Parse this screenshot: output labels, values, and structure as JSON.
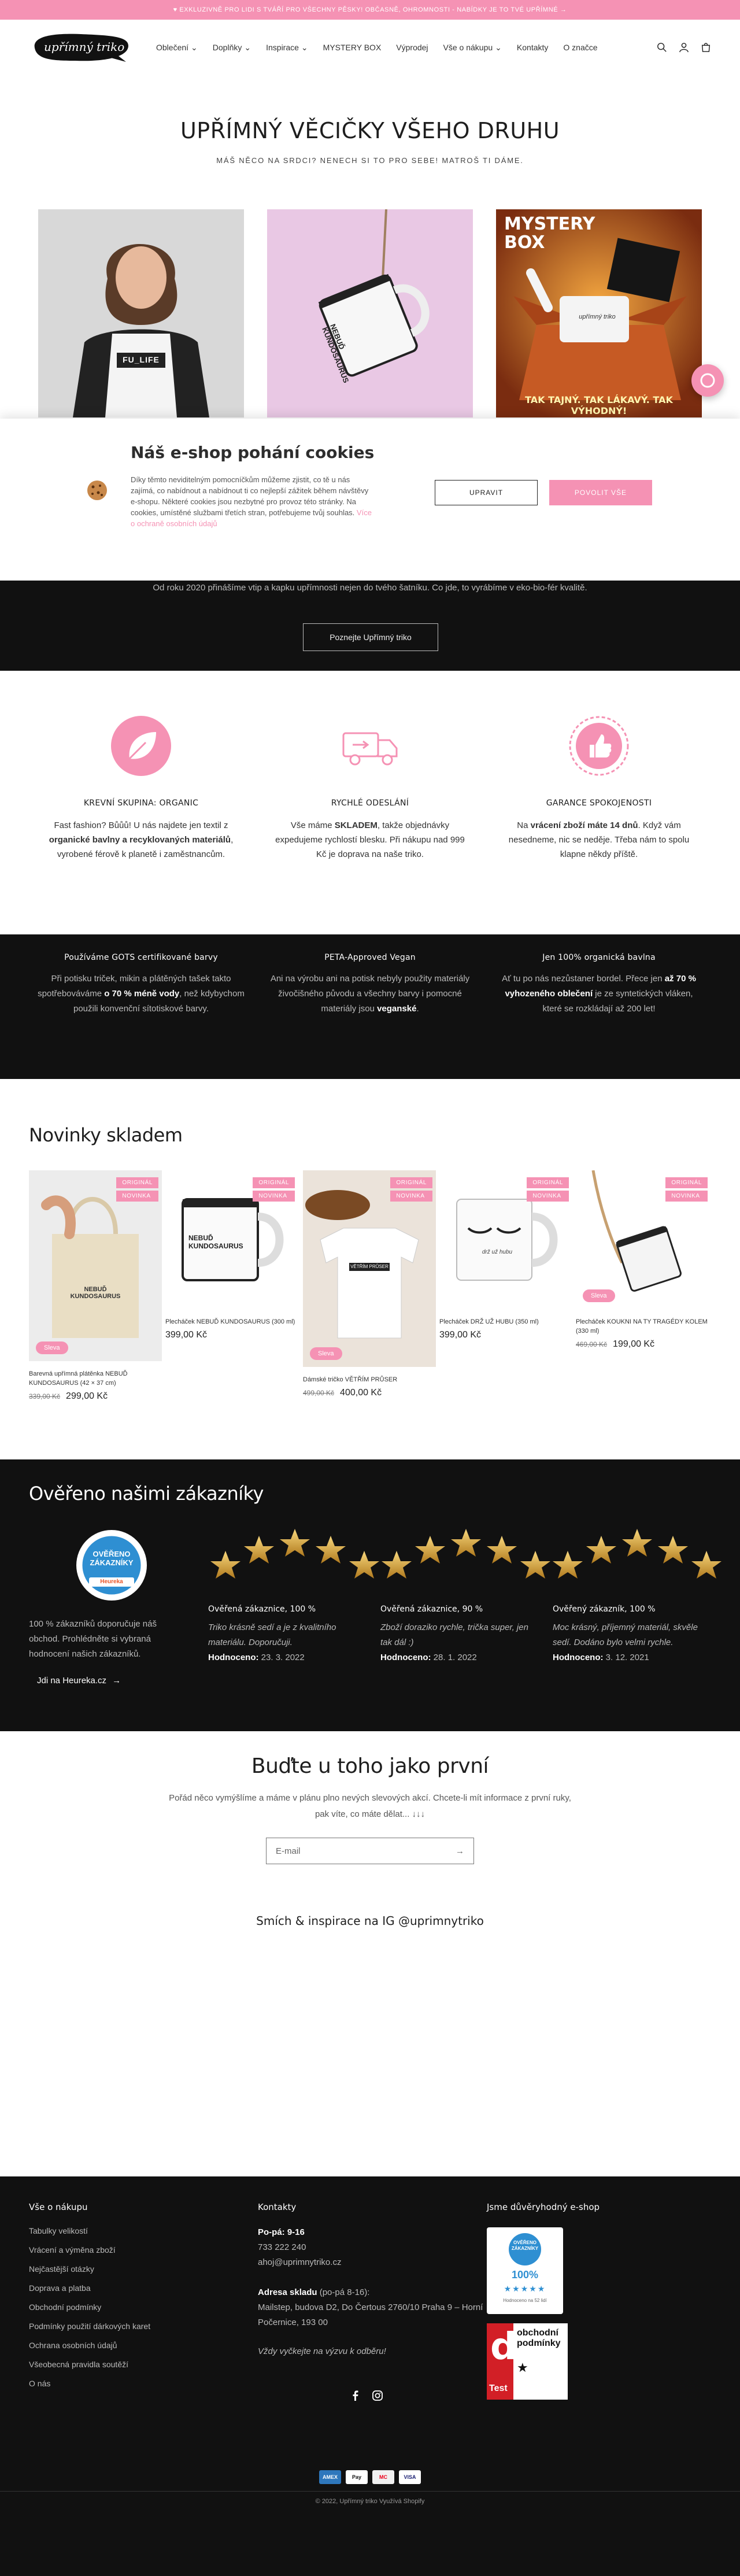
{
  "announcement": "♥ Exkluzivně pro lidi s tváří pro všechny pěsky! Občasně, ohromnosti - nabídky je to tvé upřímné →",
  "logo": "upřímný triko",
  "nav": [
    {
      "label": "Oblečení",
      "dropdown": true
    },
    {
      "label": "Doplňky",
      "dropdown": true
    },
    {
      "label": "Inspirace",
      "dropdown": true
    },
    {
      "label": "MYSTERY BOX",
      "dropdown": false
    },
    {
      "label": "Výprodej",
      "dropdown": false
    },
    {
      "label": "Vše o nákupu",
      "dropdown": true
    },
    {
      "label": "Kontakty",
      "dropdown": false
    },
    {
      "label": "O značce",
      "dropdown": false
    }
  ],
  "hero": {
    "title": "UPŘÍMNÝ VĚCIČKY VŠEHO DRUHU",
    "subtitle": "MÁŠ NĚCO NA SRDCI? NENECH SI TO PRO SEBE! MATROŠ TI DÁME."
  },
  "cards": {
    "tshirt_text": "FU_LIFE",
    "mug_text": "NEBUĎ KUNDOSAURUS",
    "mystery_title": "MYSTERY BOX",
    "mystery_tagline": "TAK TAJNÝ. TAK LÁKAVÝ. TAK VÝHODNÝ!",
    "mystery_cup": "upřímný triko"
  },
  "cookie": {
    "title": "Náš e-shop pohání cookies",
    "text": "Díky těmto neviditelným pomocníčkům můžeme zjistit, co tě u nás zajímá, co nabídnout a nabídnout ti co nejlepší zážitek během návštěvy e-shopu. Některé cookies jsou nezbytné pro provoz této stránky. Na cookies, umístěné službami třetích stran, potřebujeme tvůj souhlas.",
    "link": "Více o ochraně osobních údajů",
    "adjust": "UPRAVIT",
    "allow": "POVOLIT VŠE"
  },
  "about": {
    "text": "Od roku 2020 přinášíme vtip a kapku upřímnosti nejen do tvého šatníku. Co jde, to vyrábíme v eko-bio-fér kvalitě.",
    "button": "Poznejte Upřímný triko"
  },
  "features": [
    {
      "icon": "leaf-icon",
      "title": "KREVNÍ SKUPINA: ORGANIC",
      "pre": "Fast fashion? Bůůů! U nás najdete jen textil z ",
      "bold": "organické bavlny a recyklovaných materiálů",
      "post": ", vyrobené férově k planetě i zaměstnancům."
    },
    {
      "icon": "delivery-truck-icon",
      "title": "RYCHLÉ ODESLÁNÍ",
      "pre": "Vše máme ",
      "bold": "SKLADEM",
      "post": ", takže objednávky expedujeme rychlostí blesku. Při nákupu nad 999 Kč je doprava na naše triko."
    },
    {
      "icon": "thumbs-up-badge-icon",
      "title": "GARANCE SPOKOJENOSTI",
      "pre": "Na ",
      "bold": "vrácení zboží máte 14 dnů",
      "post": ". Když vám nesedneme, nic se neděje. Třeba nám to spolu klapne někdy příště."
    }
  ],
  "strip": [
    {
      "title": "Používáme GOTS certifikované barvy",
      "pre": "Při potisku triček, mikin a plátěných tašek takto spotřebováváme ",
      "bold": "o 70 % méně vody",
      "post": ", než kdybychom použili konvenční sítotiskové barvy."
    },
    {
      "title": "PETA-Approved Vegan",
      "pre": "Ani na výrobu ani na potisk nebyly použity materiály živočišného původu a všechny barvy i pomocné materiály jsou ",
      "bold": "veganské",
      "post": "."
    },
    {
      "title": "Jen 100% organická bavlna",
      "pre": "Ať tu po nás nezůstaner bordel. Přece jen ",
      "bold": "až 70 % vyhozeného oblečení",
      "post": " je ze syntetických vláken, které se rozkládají až 200 let!"
    }
  ],
  "products_title": "Novinky skladem",
  "products": [
    {
      "name": "Barevná upřímná plátěnka NEBUĎ KUNDOSAURUS (42 × 37 cm)",
      "old": "339,00 Kč",
      "price": "299,00 Kč",
      "badges": [
        "ORIGINÁL",
        "NOVINKA"
      ],
      "sale": "Sleva",
      "img_text": "NEBUĎ KUNDOSAURUS"
    },
    {
      "name": "Plecháček NEBUĎ KUNDOSAURUS (300 ml)",
      "old": "",
      "price": "399,00 Kč",
      "badges": [
        "ORIGINÁL",
        "NOVINKA"
      ],
      "sale": "",
      "img_text": "NEBUĎ KUNDOSAURUS"
    },
    {
      "name": "Dámské tričko VĚTŘÍM PRŮSER",
      "old": "499,00 Kč",
      "price": "400,00 Kč",
      "badges": [
        "ORIGINÁL",
        "NOVINKA"
      ],
      "sale": "Sleva",
      "img_text": "VĚTŘÍM PRŮSER"
    },
    {
      "name": "Plecháček DRŽ UŽ HUBU (350 ml)",
      "old": "",
      "price": "399,00 Kč",
      "badges": [
        "ORIGINÁL",
        "NOVINKA"
      ],
      "sale": "",
      "img_text": "drž už hubu"
    },
    {
      "name": "Plecháček KOUKNI NA TY TRAGÉDY KOLEM (330 ml)",
      "old": "469,00 Kč",
      "price": "199,00 Kč",
      "badges": [
        "ORIGINÁL",
        "NOVINKA"
      ],
      "sale": "Sleva",
      "img_text": ""
    }
  ],
  "reviews": {
    "title": "Ověřeno našimi zákazníky",
    "heureka_badge": "OVĚŘENO ZÁKAZNÍKY",
    "heureka_brand": "Heureka",
    "text": "100 % zákazníků doporučuje náš obchod. Prohlédněte si vybraná hodnocení našich zákazníků.",
    "link": "Jdi na Heureka.cz",
    "rated_label": "Hodnoceno:",
    "items": [
      {
        "who": "Ověřená zákaznice, 100 %",
        "text": "Triko krásně sedí a je z kvalitního materiálu. Doporučuji.",
        "date": "23. 3. 2022"
      },
      {
        "who": "Ověřená zákaznice, 90 %",
        "text": "Zboží doraziko rychle, trička super, jen tak dál :)",
        "date": "28. 1. 2022"
      },
      {
        "who": "Ověřený zákazník, 100 %",
        "text": "Moc krásný, příjemný materiál, skvěle sedí. Dodáno bylo velmi rychle.",
        "date": "3. 12. 2021"
      }
    ]
  },
  "newsletter": {
    "title": "Buďte u toho jako první",
    "text": "Pořád něco vymýšlíme a máme v plánu plno nevých slevových akcí. Chcete-li mít informace z první ruky, pak víte, co máte dělat... ↓↓↓",
    "placeholder": "E-mail"
  },
  "instagram": "Smích & inspirace na IG @uprimnytriko",
  "footer": {
    "col1_title": "Vše o nákupu",
    "links": [
      "Tabulky velikostí",
      "Vrácení a výměna zboží",
      "Nejčastější otázky",
      "Doprava a platba",
      "Obchodní podmínky",
      "Podmínky použití dárkových karet",
      "Ochrana osobních údajů",
      "Všeobecná pravidla soutěží",
      "O nás"
    ],
    "col2_title": "Kontakty",
    "hours": "Po-pá: 9-16",
    "phone": "733 222 240",
    "email": "ahoj@uprimnytriko.cz",
    "addr_title": "Adresa skladu",
    "addr_hours": "(po-pá 8-16):",
    "addr": "Mailstep, budova D2, Do Čertous 2760/10 Praha 9 – Horní Počernice, 193 00",
    "note": "Vždy vyčkejte na výzvu k odběru!",
    "col3_title": "Jsme důvěryhodný e-shop",
    "heureka_small": "OVĚŘENO ZÁKAZNÍKY",
    "heureka_pct": "100%",
    "heureka_sub": "Hodnoceno na 52 lidí",
    "dtest_title": "obchodní podmínky",
    "dtest_letter": "d",
    "dtest_word": "Test",
    "payments": [
      "AMEX",
      "Pay",
      "MC",
      "VISA"
    ],
    "copyright": "© 2022, Upřímný triko Využívá Shopify"
  },
  "colors": {
    "accent": "#f592b4",
    "dark": "#111111"
  }
}
